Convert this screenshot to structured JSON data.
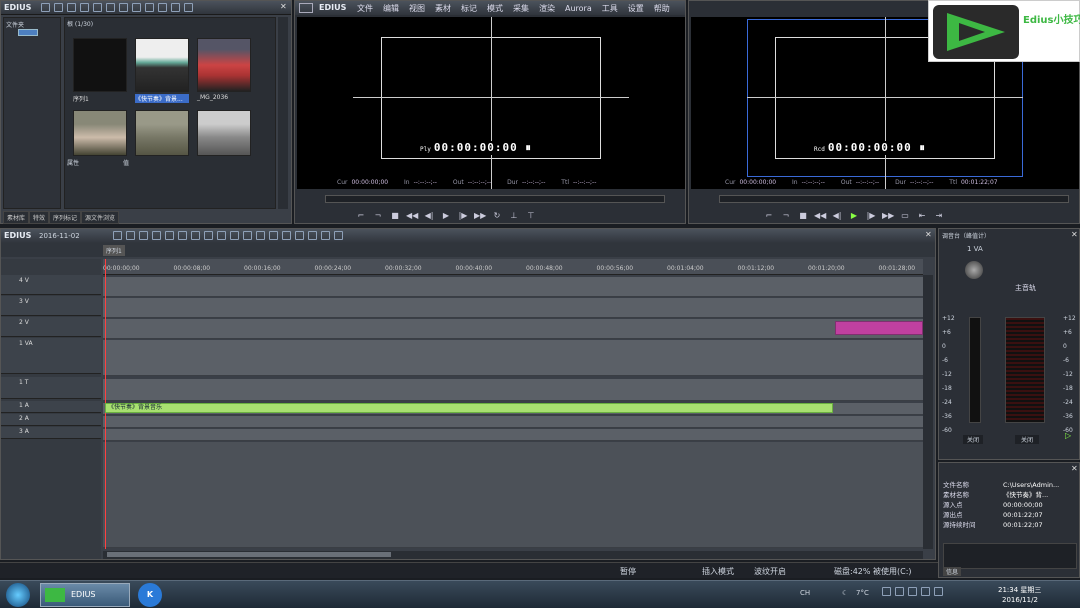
{
  "app": {
    "name": "EDIUS"
  },
  "bin": {
    "folder_label": "文件夹",
    "path_label": "根 (1/30)",
    "clips": [
      {
        "label": "序列1"
      },
      {
        "label": "《快节奏》背景..."
      },
      {
        "label": "_MG_2036"
      }
    ],
    "props_label": "属性",
    "value_label": "值",
    "tabs": [
      "素材库",
      "特效",
      "序列标记",
      "源文件浏览"
    ]
  },
  "player": {
    "menu": [
      "文件",
      "编辑",
      "视图",
      "素材",
      "标记",
      "模式",
      "采集",
      "渲染",
      "Aurora",
      "工具",
      "设置",
      "帮助"
    ],
    "tc_prefix": "Ply",
    "timecode": "00:00:00:00",
    "cur_label": "Cur",
    "cur": "00:00:00;00",
    "in_label": "In",
    "in": "--:--:--;--",
    "out_label": "Out",
    "out": "--:--:--;--",
    "dur_label": "Dur",
    "dur": "--:--:--;--",
    "ttl_label": "Ttl",
    "ttl": "--:--:--;--"
  },
  "recorder": {
    "tc_prefix": "Rcd",
    "timecode": "00:00:00:00",
    "cur_label": "Cur",
    "cur": "00:00:00;00",
    "in_label": "In",
    "in": "--:--:--;--",
    "out_label": "Out",
    "out": "--:--:--;--",
    "dur_label": "Dur",
    "dur": "--:--:--;--",
    "ttl_label": "Ttl",
    "ttl": "00:01:22;07"
  },
  "logo": {
    "text": "Edius小技巧",
    "color": "#3db843"
  },
  "timeline": {
    "title": "EDIUS",
    "date": "2016-11-02",
    "sequence_tab": "序列1",
    "ruler": [
      "00:00:00;00",
      "00:00:08;00",
      "00:00:16;00",
      "00:00:24;00",
      "00:00:32;00",
      "00:00:40;00",
      "00:00:48;00",
      "00:00:56;00",
      "00:01:04;00",
      "00:01:12;00",
      "00:01:20;00",
      "00:01:28;00"
    ],
    "tracks": [
      {
        "name": "4 V"
      },
      {
        "name": "3 V"
      },
      {
        "name": "2 V"
      },
      {
        "name": "1 VA"
      },
      {
        "name": "1 T"
      },
      {
        "name": "1 A"
      },
      {
        "name": "2 A"
      },
      {
        "name": "3 A"
      }
    ],
    "audio_clip": "《快节奏》背景音乐"
  },
  "mixer": {
    "title": "调音台（峰值计）",
    "channel": "1 VA",
    "master": "主音轨",
    "scale": [
      "+12",
      "+6",
      "0",
      "-6",
      "-12",
      "-18",
      "-24",
      "-36",
      "-60"
    ],
    "off1": "关闭",
    "off2": "关闭"
  },
  "info": {
    "rows": [
      {
        "k": "文件名称",
        "v": "C:\\Users\\Admin..."
      },
      {
        "k": "素材名称",
        "v": "《快节奏》背..."
      },
      {
        "k": "源入点",
        "v": "00:00:00;00"
      },
      {
        "k": "源出点",
        "v": "00:01:22;07"
      },
      {
        "k": "源持续时间",
        "v": "00:01:22;07"
      }
    ],
    "tab": "信息"
  },
  "status": {
    "pause": "暂停",
    "insert": "插入模式",
    "ripple": "波纹开启",
    "disk": "磁盘:42% 被使用(C:)"
  },
  "taskbar": {
    "app": "EDIUS",
    "temp": "7°C",
    "time": "21:34 星期三",
    "date": "2016/11/2",
    "ime": "CH"
  }
}
